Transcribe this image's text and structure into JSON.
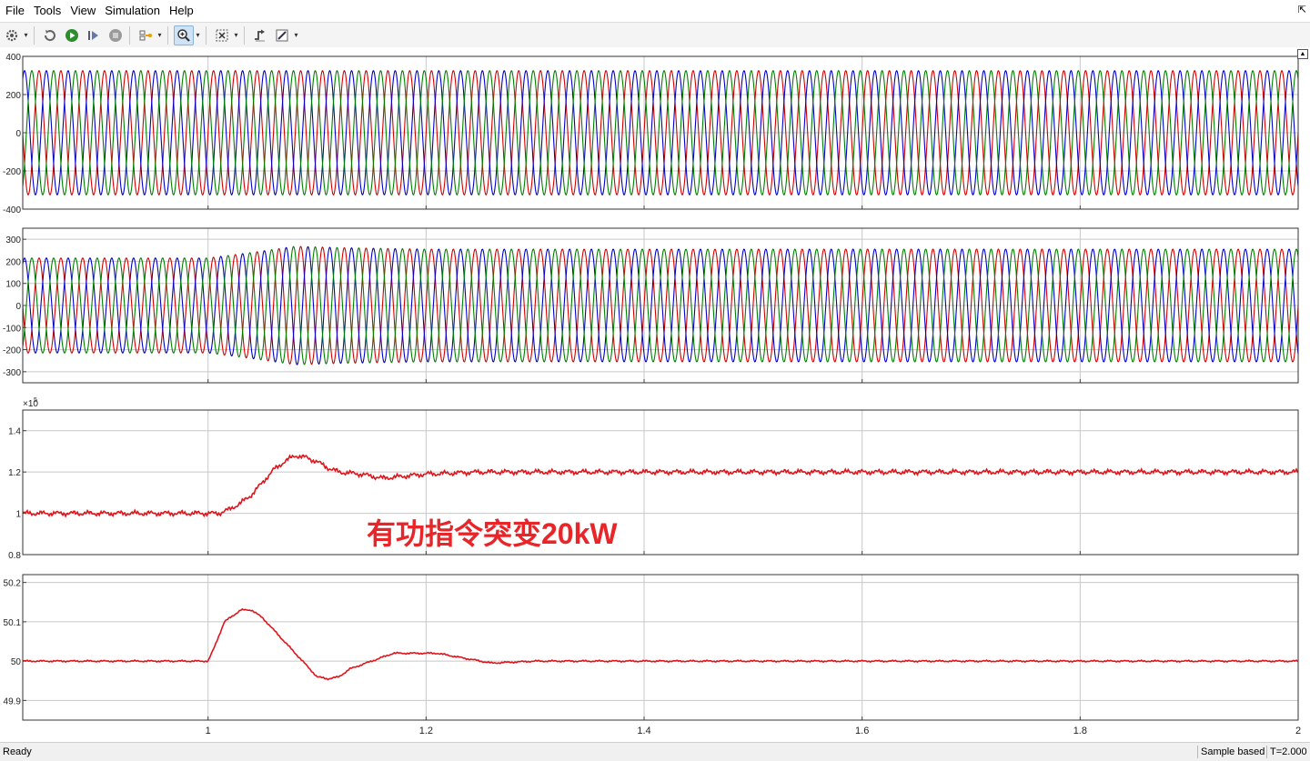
{
  "menu": {
    "items": [
      "File",
      "Tools",
      "View",
      "Simulation",
      "Help"
    ]
  },
  "toolbar": {
    "buttons": [
      "settings-icon",
      "restore-icon",
      "run-icon",
      "step-forward-icon",
      "stop-icon",
      "highlight-icon",
      "zoom-icon",
      "fit-to-view-icon",
      "triggers-icon",
      "style-icon"
    ]
  },
  "status": {
    "ready": "Ready",
    "mode": "Sample based",
    "time": "T=2.000"
  },
  "annotation": {
    "text": "有功指令突变20kW",
    "color": "#e8262a"
  },
  "colors": {
    "phase_a": "#d40000",
    "phase_b": "#0000cc",
    "phase_c": "#008000",
    "signal": "#e0141b",
    "grid": "#c8c8c8"
  },
  "chart_data": [
    {
      "type": "line",
      "description_role": "three-phase voltage",
      "x_range": [
        0.83,
        2.0
      ],
      "ylim": [
        -400,
        400
      ],
      "yticks": [
        -400,
        -200,
        0,
        200,
        400
      ],
      "ytick_labels": [
        "-400",
        "-200",
        "0",
        "200",
        "400"
      ],
      "xticks": [
        1,
        1.2,
        1.4,
        1.6,
        1.8,
        2
      ],
      "xtick_labels": [
        "",
        "",
        "",
        "",
        "",
        ""
      ],
      "grid": true,
      "frequency_hz": 50,
      "series": [
        {
          "color": "#d40000",
          "amplitude": 325,
          "phase_deg": 0
        },
        {
          "color": "#0000cc",
          "amplitude": 325,
          "phase_deg": -120
        },
        {
          "color": "#008000",
          "amplitude": 325,
          "phase_deg": 120
        }
      ]
    },
    {
      "type": "line",
      "x_range": [
        0.83,
        2.0
      ],
      "ylim": [
        -350,
        350
      ],
      "yticks": [
        -300,
        -200,
        -100,
        0,
        100,
        200,
        300
      ],
      "ytick_labels": [
        "-300",
        "-200",
        "-100",
        "0",
        "100",
        "200",
        "300"
      ],
      "xticks": [
        1,
        1.2,
        1.4,
        1.6,
        1.8,
        2
      ],
      "xtick_labels": [
        "",
        "",
        "",
        "",
        "",
        ""
      ],
      "grid": true,
      "frequency_hz": 50,
      "amplitude_envelope": [
        [
          0.83,
          215
        ],
        [
          1.0,
          215
        ],
        [
          1.04,
          240
        ],
        [
          1.08,
          268
        ],
        [
          1.12,
          262
        ],
        [
          1.2,
          255
        ],
        [
          2.0,
          255
        ]
      ],
      "series": [
        {
          "color": "#d40000",
          "phase_deg": 0
        },
        {
          "color": "#0000cc",
          "phase_deg": -120
        },
        {
          "color": "#008000",
          "phase_deg": 120
        }
      ]
    },
    {
      "type": "line",
      "x_range": [
        0.83,
        2.0
      ],
      "ylim": [
        0.8,
        1.5
      ],
      "yticks": [
        0.8,
        1,
        1.2,
        1.4
      ],
      "ytick_labels": [
        "0.8",
        "1",
        "1.2",
        "1.4"
      ],
      "exponent_label": "×10",
      "exponent_power": "5",
      "xticks": [
        1,
        1.2,
        1.4,
        1.6,
        1.8,
        2
      ],
      "xtick_labels": [
        "",
        "",
        "",
        "",
        "",
        ""
      ],
      "grid": true,
      "series": [
        {
          "color": "#e0141b",
          "points": [
            [
              0.83,
              1.0
            ],
            [
              1.0,
              1.0
            ],
            [
              1.01,
              1.0
            ],
            [
              1.02,
              1.02
            ],
            [
              1.03,
              1.05
            ],
            [
              1.04,
              1.09
            ],
            [
              1.05,
              1.15
            ],
            [
              1.06,
              1.21
            ],
            [
              1.07,
              1.25
            ],
            [
              1.08,
              1.28
            ],
            [
              1.09,
              1.27
            ],
            [
              1.1,
              1.25
            ],
            [
              1.11,
              1.22
            ],
            [
              1.12,
              1.2
            ],
            [
              1.14,
              1.19
            ],
            [
              1.16,
              1.17
            ],
            [
              1.18,
              1.18
            ],
            [
              1.2,
              1.19
            ],
            [
              1.25,
              1.2
            ],
            [
              2.0,
              1.2
            ]
          ]
        }
      ]
    },
    {
      "type": "line",
      "x_range": [
        0.83,
        2.0
      ],
      "ylim": [
        49.85,
        50.22
      ],
      "yticks": [
        49.9,
        50,
        50.1,
        50.2
      ],
      "ytick_labels": [
        "49.9",
        "50",
        "50.1",
        "50.2"
      ],
      "xticks": [
        1,
        1.2,
        1.4,
        1.6,
        1.8,
        2
      ],
      "xtick_labels": [
        "1",
        "1.2",
        "1.4",
        "1.6",
        "1.8",
        "2"
      ],
      "grid": true,
      "series": [
        {
          "color": "#e0141b",
          "points": [
            [
              0.83,
              50.0
            ],
            [
              1.0,
              50.0
            ],
            [
              1.005,
              50.03
            ],
            [
              1.015,
              50.1
            ],
            [
              1.03,
              50.13
            ],
            [
              1.04,
              50.13
            ],
            [
              1.05,
              50.11
            ],
            [
              1.06,
              50.08
            ],
            [
              1.07,
              50.05
            ],
            [
              1.08,
              50.02
            ],
            [
              1.09,
              49.99
            ],
            [
              1.1,
              49.96
            ],
            [
              1.11,
              49.955
            ],
            [
              1.12,
              49.96
            ],
            [
              1.13,
              49.98
            ],
            [
              1.15,
              50.0
            ],
            [
              1.17,
              50.02
            ],
            [
              1.19,
              50.02
            ],
            [
              1.21,
              50.02
            ],
            [
              1.23,
              50.01
            ],
            [
              1.26,
              49.995
            ],
            [
              1.3,
              50.0
            ],
            [
              2.0,
              50.0
            ]
          ]
        }
      ]
    }
  ]
}
